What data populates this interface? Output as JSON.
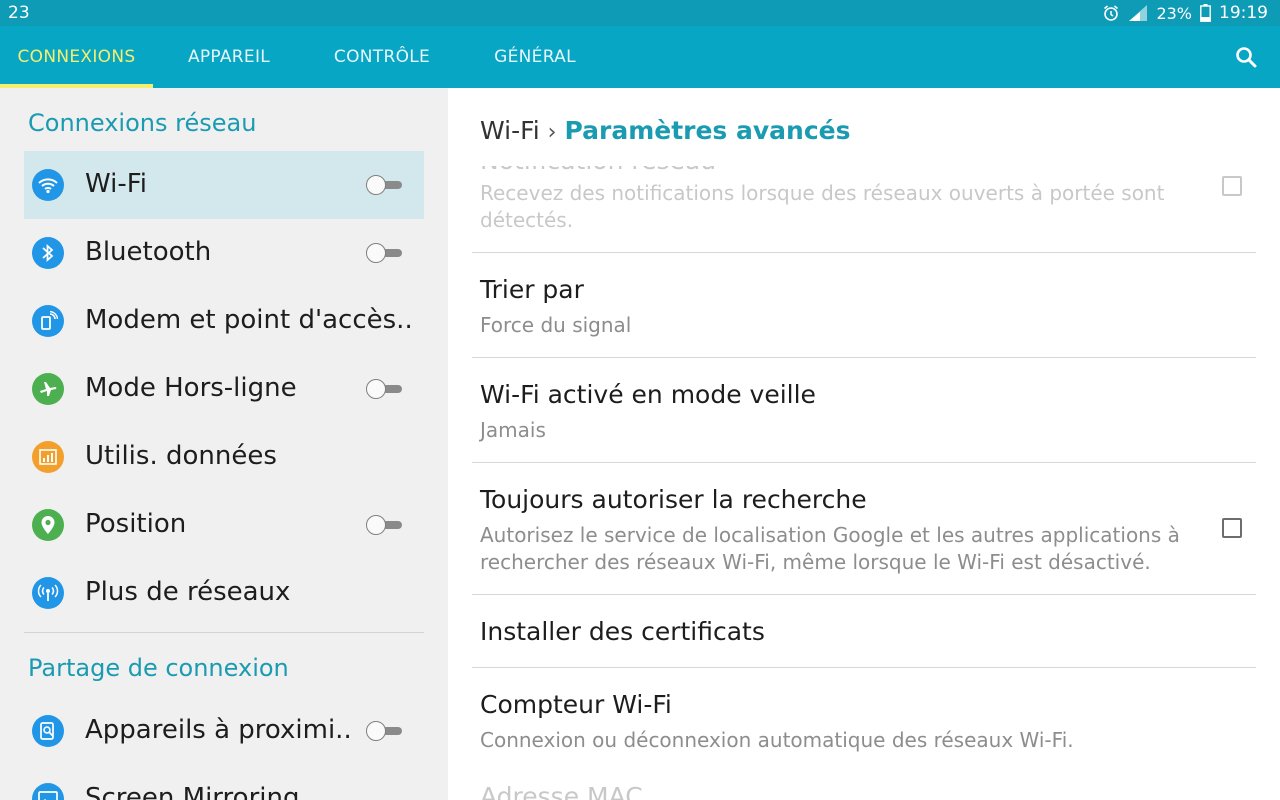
{
  "status_bar": {
    "notification_count": "23",
    "battery": "23%",
    "time": "19:19",
    "icons": [
      "alarm-icon",
      "signal-icon",
      "battery-icon"
    ]
  },
  "tabs": [
    {
      "label": "CONNEXIONS",
      "active": true
    },
    {
      "label": "APPAREIL",
      "active": false
    },
    {
      "label": "CONTRÔLE",
      "active": false
    },
    {
      "label": "GÉNÉRAL",
      "active": false
    }
  ],
  "left_panel": {
    "section1": "Connexions réseau",
    "items": [
      {
        "label": "Wi-Fi",
        "icon": "wifi-icon",
        "toggle": true,
        "selected": true
      },
      {
        "label": "Bluetooth",
        "icon": "bluetooth-icon",
        "toggle": true
      },
      {
        "label": "Modem et point d'accès..",
        "icon": "hotspot-icon",
        "toggle": false
      },
      {
        "label": "Mode Hors-ligne",
        "icon": "airplane-icon",
        "toggle": true
      },
      {
        "label": "Utilis. données",
        "icon": "data-usage-icon",
        "toggle": false
      },
      {
        "label": "Position",
        "icon": "location-pin-icon",
        "toggle": true
      },
      {
        "label": "Plus de réseaux",
        "icon": "more-networks-icon",
        "toggle": false
      }
    ],
    "section2": "Partage de connexion",
    "items2": [
      {
        "label": "Appareils à proximi..",
        "icon": "nearby-devices-icon",
        "toggle": true
      },
      {
        "label": "Screen Mirroring",
        "icon": "screen-mirroring-icon",
        "toggle": false
      }
    ]
  },
  "right_panel": {
    "breadcrumb": {
      "root": "Wi-Fi",
      "separator": "›",
      "current": "Paramètres avancés"
    },
    "settings": [
      {
        "title": "Notification réseau",
        "subtitle": "Recevez des notifications lorsque des réseaux ouverts à portée sont détectés.",
        "checkbox": true
      },
      {
        "title": "Trier par",
        "subtitle": "Force du signal"
      },
      {
        "title": "Wi-Fi activé en mode veille",
        "subtitle": "Jamais"
      },
      {
        "title": "Toujours autoriser la recherche",
        "subtitle": "Autorisez le service de localisation Google et les autres applications à rechercher des réseaux Wi-Fi, même lorsque le Wi-Fi est désactivé.",
        "checkbox": true
      },
      {
        "title": "Installer des certificats"
      },
      {
        "title": "Compteur Wi-Fi",
        "subtitle": "Connexion ou déconnexion automatique des réseaux Wi-Fi."
      },
      {
        "title": "Adresse MAC"
      }
    ]
  },
  "colors": {
    "status_bar": "#0e9bb6",
    "tab_bar": "#06a6c4",
    "active_tab": "#f5ee6e",
    "section_title": "#1a9bb1",
    "icon_blue": "#2196e6",
    "icon_green": "#4caf50",
    "icon_orange": "#f2a02b"
  }
}
